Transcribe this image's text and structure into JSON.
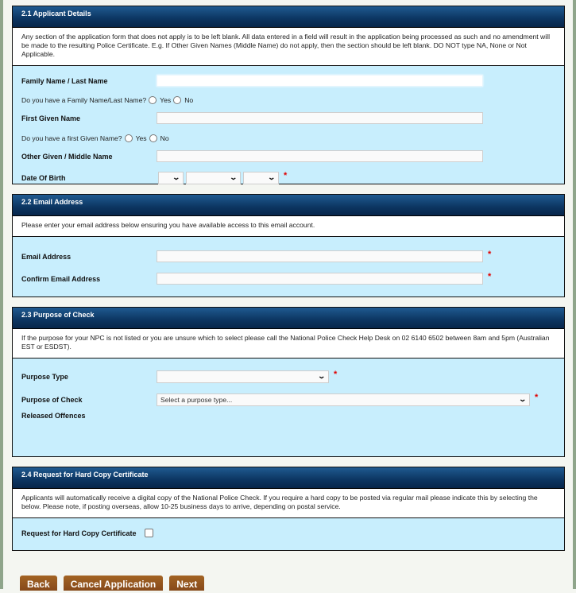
{
  "sections": [
    {
      "title": "2.1 Applicant Details",
      "description": "Any section of the application form that does not apply is to be left blank. All data entered in a field will result in the application being processed as such and no amendment will be made to the resulting Police Certificate. E.g. If Other Given Names (Middle Name) do not apply, then the section should be left blank. DO NOT type NA, None or Not Applicable.",
      "fields": {
        "family_name": {
          "label": "Family Name / Last Name",
          "value": ""
        },
        "family_name_question": {
          "label": "Do you have a Family Name/Last Name?",
          "yes": "Yes",
          "no": "No"
        },
        "first_given_name": {
          "label": "First Given Name",
          "value": ""
        },
        "first_given_question": {
          "label": "Do you have a first Given Name?",
          "yes": "Yes",
          "no": "No"
        },
        "middle_name": {
          "label": "Other Given / Middle Name",
          "value": ""
        },
        "dob": {
          "label": "Date Of Birth",
          "day": "",
          "month": "",
          "year": "",
          "required": "*"
        }
      }
    },
    {
      "title": "2.2 Email Address",
      "description": "Please enter your email address below ensuring you have available access to this email account.",
      "fields": {
        "email": {
          "label": "Email Address",
          "value": "",
          "required": "*"
        },
        "confirm_email": {
          "label": "Confirm Email Address",
          "value": "",
          "required": "*"
        }
      }
    },
    {
      "title": "2.3 Purpose of Check",
      "description": "If the purpose for your NPC is not listed or you are unsure which to select please call the National Police Check Help Desk on 02 6140 6502 between 8am and 5pm (Australian EST or ESDST).",
      "fields": {
        "purpose_type": {
          "label": "Purpose Type",
          "value": "",
          "required": "*"
        },
        "purpose_of_check": {
          "label": "Purpose of Check",
          "value": "Select a purpose type...",
          "required": "*"
        },
        "released_offences": {
          "label": "Released Offences"
        }
      }
    },
    {
      "title": "2.4 Request for Hard Copy Certificate",
      "description": "Applicants will automatically receive a digital copy of the National Police Check. If you require a hard copy to be posted via regular mail please indicate this by selecting the below. Please note, if posting overseas, allow 10-25 business days to arrive, depending on postal service.",
      "fields": {
        "hard_copy": {
          "label": "Request for Hard Copy Certificate",
          "checked": false
        }
      }
    }
  ],
  "buttons": {
    "back": "Back",
    "cancel": "Cancel Application",
    "next": "Next"
  },
  "icons": {
    "chevron": "⌄"
  }
}
